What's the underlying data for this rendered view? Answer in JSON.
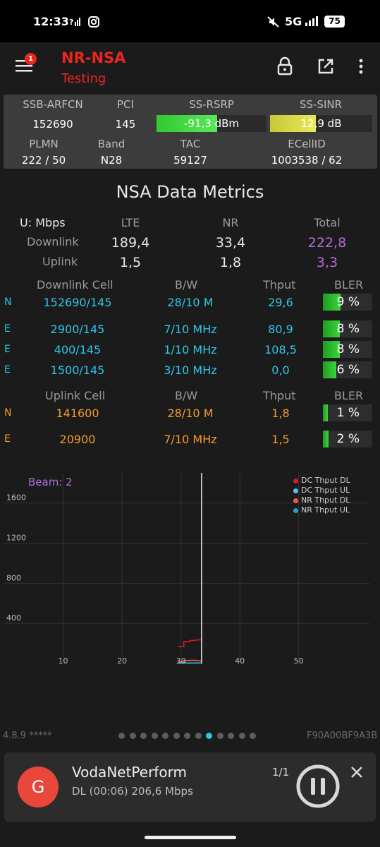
{
  "status_bar": {
    "time": "12:33",
    "network": "5G",
    "battery": "75",
    "icons": [
      "signal-icon",
      "instagram-icon",
      "mute-icon",
      "signal-bars-icon",
      "battery-icon"
    ]
  },
  "toolbar": {
    "title": "NR-NSA",
    "subtitle": "Testing",
    "badge": "1",
    "icons": [
      "menu-icon",
      "lock-icon",
      "open-external-icon",
      "more-vert-icon"
    ]
  },
  "panel": {
    "labels": {
      "ssb_arfcn": "SSB-ARFCN",
      "pci": "PCI",
      "ss_rsrp": "SS-RSRP",
      "ss_sinr": "SS-SINR",
      "plmn": "PLMN",
      "band": "Band",
      "tac": "TAC",
      "ecellid": "ECellID"
    },
    "values": {
      "ssb_arfcn": "152690",
      "pci": "145",
      "ss_rsrp": "-91,3 dBm",
      "ss_sinr": "12,9 dB",
      "plmn": "222 / 50",
      "band": "N28",
      "tac": "59127",
      "ecellid": "1003538 / 62"
    },
    "rsrp_level": 0.55,
    "sinr_level": 0.45,
    "rsrp_color": "#32c932",
    "sinr_color": "#c7c737"
  },
  "metrics": {
    "title": "NSA Data Metrics",
    "unit": "U: Mbps",
    "col_lte": "LTE",
    "col_nr": "NR",
    "col_total": "Total",
    "downlink_label": "Downlink",
    "uplink_label": "Uplink",
    "downlink": {
      "lte": "189,4",
      "nr": "33,4",
      "total": "222,8"
    },
    "uplink": {
      "lte": "1,5",
      "nr": "1,8",
      "total": "3,3"
    },
    "dl_header": {
      "cell": "Downlink Cell",
      "bw": "B/W",
      "thput": "Thput",
      "bler": "BLER"
    },
    "dl_cells": [
      {
        "tech": "N",
        "cell": "152690/145",
        "bw": "28/10 M",
        "thput": "29,6",
        "bler": "9 %",
        "bler_level": 0.36
      },
      {
        "tech": "E",
        "cell": "2900/145",
        "bw": "7/10 MHz",
        "thput": "80,9",
        "bler": "8 %",
        "bler_level": 0.34
      },
      {
        "tech": "E",
        "cell": "400/145",
        "bw": "1/10 MHz",
        "thput": "108,5",
        "bler": "8 %",
        "bler_level": 0.34
      },
      {
        "tech": "E",
        "cell": "1500/145",
        "bw": "3/10 MHz",
        "thput": "0,0",
        "bler": "6 %",
        "bler_level": 0.27
      }
    ],
    "ul_header": {
      "cell": "Uplink Cell",
      "bw": "B/W",
      "thput": "Thput",
      "bler": "BLER"
    },
    "ul_cells": [
      {
        "tech": "N",
        "cell": "141600",
        "bw": "28/10 M",
        "thput": "1,8",
        "bler": "1 %",
        "bler_level": 0.1
      },
      {
        "tech": "E",
        "cell": "20900",
        "bw": "7/10 MHz",
        "thput": "1,5",
        "bler": "2 %",
        "bler_level": 0.12
      }
    ]
  },
  "chart_data": {
    "type": "line",
    "annotation": "Beam: 2",
    "x_ticks": [
      "10",
      "20",
      "30",
      "40",
      "50"
    ],
    "y_ticks": [
      "400",
      "800",
      "1200",
      "1600"
    ],
    "xlim": [
      0,
      62
    ],
    "ylim": [
      0,
      1900
    ],
    "cursor_x": 33.5,
    "legend_position": "top-right",
    "series": [
      {
        "name": "DC Thput DL",
        "color": "#e01919",
        "x": [
          29.5,
          30.5,
          31.5,
          32.5,
          33.5
        ],
        "y": [
          170,
          220,
          230,
          235,
          225
        ]
      },
      {
        "name": "DC Thput UL",
        "color": "#4fc3f7",
        "x": [
          29.5,
          30.5,
          31.5,
          32.5,
          33.5
        ],
        "y": [
          5,
          5,
          5,
          5,
          5
        ]
      },
      {
        "name": "NR Thput DL",
        "color": "#f25a4a",
        "x": [
          29.5,
          30.5,
          31.5,
          32.5,
          33.5
        ],
        "y": [
          15,
          30,
          32,
          28,
          30
        ]
      },
      {
        "name": "NR Thput UL",
        "color": "#1aa7d8",
        "x": [
          29.5,
          30.5,
          31.5,
          32.5,
          33.5
        ],
        "y": [
          3,
          3,
          3,
          3,
          3
        ]
      }
    ]
  },
  "footer": {
    "version": "4.8.9 *****",
    "device_id": "F90A00BF9A3B",
    "page_count": 13,
    "active_page": 8
  },
  "notification": {
    "avatar_letter": "G",
    "avatar_color": "#e8473a",
    "app": "VodaNetPerform",
    "detail": "DL (00:06) 206,6 Mbps",
    "counter": "1/1"
  }
}
